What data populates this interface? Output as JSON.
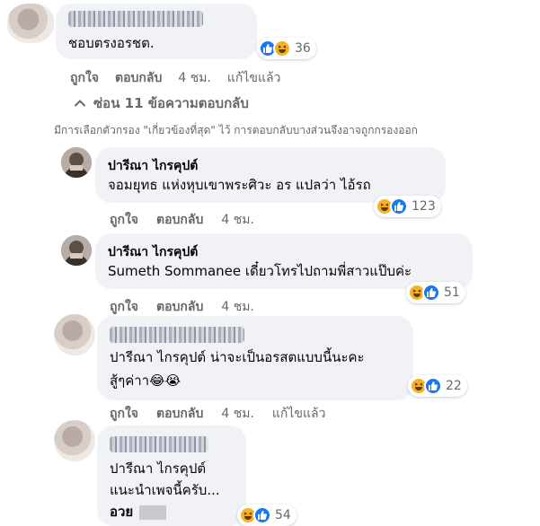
{
  "comment_top": {
    "text": "ชอบตรงอรชต.",
    "reaction_count": "36",
    "like_label": "ถูกใจ",
    "reply_label": "ตอบกลับ",
    "time": "4 ชม.",
    "edited": "แก้ไขแล้ว"
  },
  "replies_control": {
    "label": "ซ่อน 11 ข้อความตอบกลับ",
    "filter_note": "มีการเลือกตัวกรอง \"เกี่ยวข้องที่สุด\" ไว้ การตอบกลับบางส่วนจึงอาจถูกกรองออก"
  },
  "replies": [
    {
      "name": "ปารีณา ไกรคุปต์",
      "lines": [
        "จอมยุทธ แห่งหุบเขาพระศิวะ อร แปลว่า ไอ้รถ"
      ],
      "reaction_count": "123",
      "like_label": "ถูกใจ",
      "reply_label": "ตอบกลับ",
      "time": "4 ชม."
    },
    {
      "name": "ปารีณา ไกรคุปต์",
      "lines": [
        "Sumeth Sommanee เดี๋ยวโทรไปถามพี่สาวแป๊บค่ะ"
      ],
      "reaction_count": "51",
      "like_label": "ถูกใจ",
      "reply_label": "ตอบกลับ",
      "time": "4 ชม."
    },
    {
      "lines": [
        "ปารีณา ไกรคุปต์ น่าจะเป็นอรสตแบบนี้นะคะ",
        "สู้ๆค่าา😂😭"
      ],
      "reaction_count": "22",
      "like_label": "ถูกใจ",
      "reply_label": "ตอบกลับ",
      "time": "4 ชม.",
      "edited": "แก้ไขแล้ว"
    },
    {
      "lines": [
        "ปารีณา ไกรคุปต์",
        "แนะนำเพจนี้ครับ...",
        "อวย"
      ],
      "reaction_count": "54"
    }
  ],
  "colors": {
    "bubble": "#f0f2f5",
    "like_blue": "#1877f2",
    "haha_yellow": "#f7b125",
    "meta_gray": "#65676b"
  },
  "icons": [
    "like-icon",
    "haha-icon",
    "chevron-up-icon"
  ]
}
